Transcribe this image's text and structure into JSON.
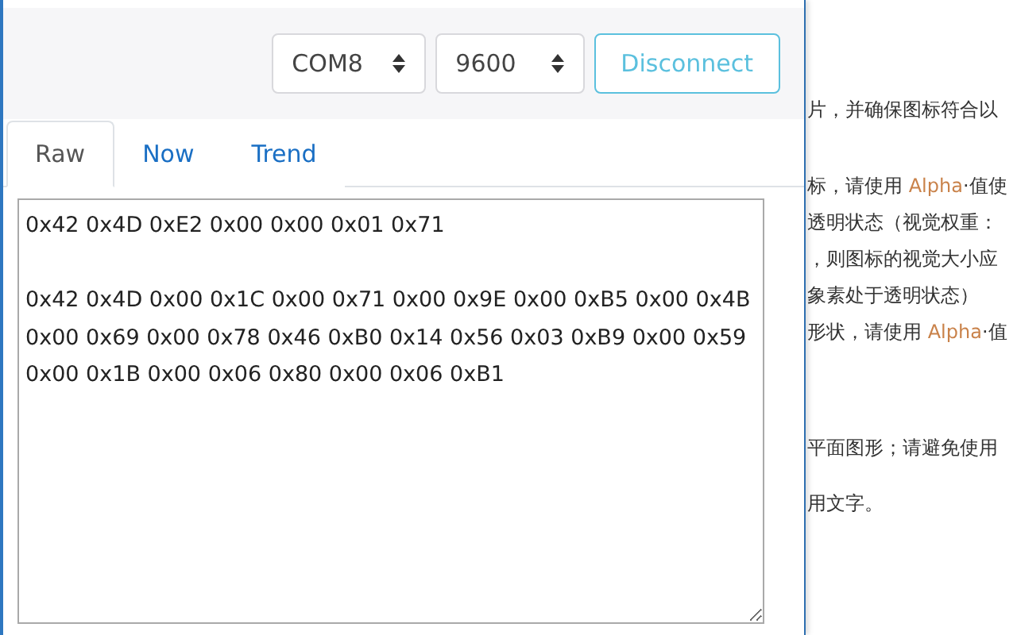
{
  "toolbar": {
    "port": "COM8",
    "baud": "9600",
    "connect_button": "Disconnect"
  },
  "tabs": [
    {
      "label": "Raw",
      "selected": true
    },
    {
      "label": "Now",
      "selected": false
    },
    {
      "label": "Trend",
      "selected": false
    }
  ],
  "raw_output": "0x42 0x4D 0xE2 0x00 0x00 0x01 0x71\n\n0x42 0x4D 0x00 0x1C 0x00 0x71 0x00 0x9E 0x00 0xB5 0x00 0x4B\n0x00 0x69 0x00 0x78 0x46 0xB0 0x14 0x56 0x03 0xB9 0x00 0x59\n0x00 0x1B 0x00 0x06 0x80 0x00 0x06 0xB1",
  "background_document": {
    "paragraphs": [
      [
        [
          {
            "kind": "text",
            "text": "片，并确保图标符合以"
          }
        ]
      ],
      [
        [
          {
            "kind": "text",
            "text": "标，请使用 "
          },
          {
            "kind": "code",
            "text": "Alpha"
          },
          {
            "kind": "text",
            "text": "·值使"
          }
        ],
        [
          {
            "kind": "text",
            "text": "透明状态（视觉权重："
          }
        ],
        [
          {
            "kind": "text",
            "text": "，则图标的视觉大小应"
          }
        ],
        [
          {
            "kind": "text",
            "text": "象素处于透明状态）"
          }
        ],
        [
          {
            "kind": "text",
            "text": "形状，请使用 "
          },
          {
            "kind": "code",
            "text": "Alpha"
          },
          {
            "kind": "text",
            "text": "·值"
          }
        ]
      ],
      [
        [
          {
            "kind": "text",
            "text": "平面图形；请避免使用"
          }
        ]
      ],
      [
        [
          {
            "kind": "text",
            "text": "用文字。"
          }
        ]
      ]
    ]
  }
}
